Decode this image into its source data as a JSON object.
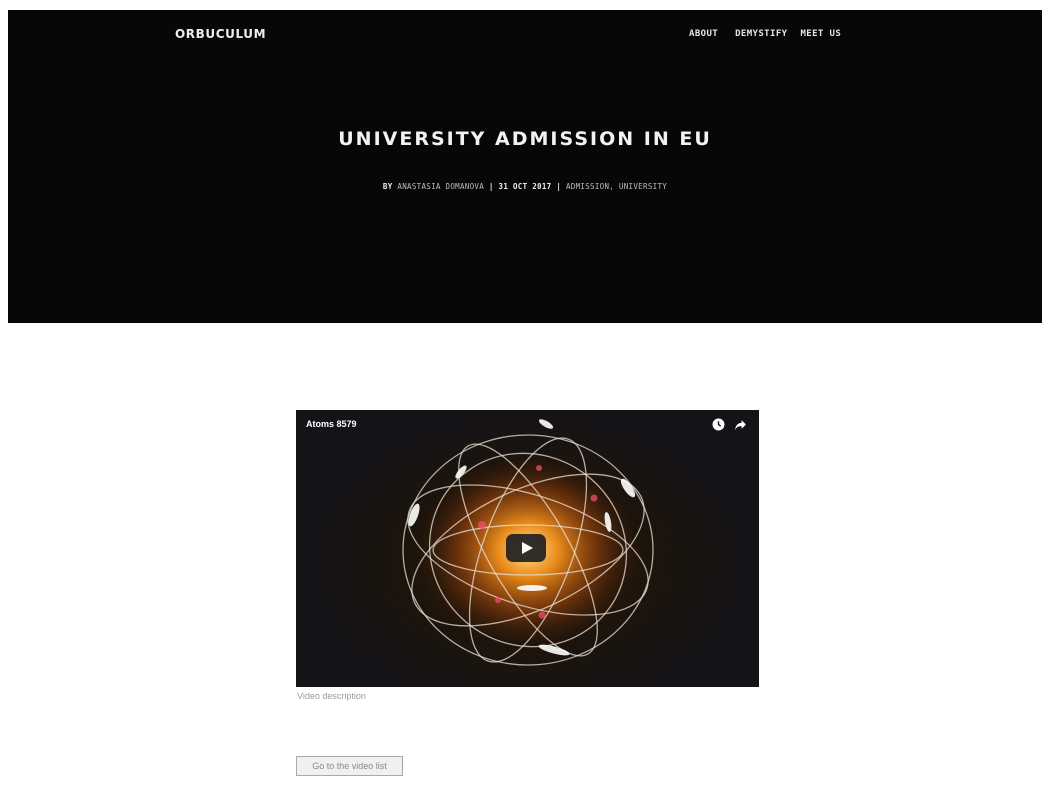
{
  "header": {
    "brand": "ORBUCULUM",
    "nav": [
      "ABOUT",
      "DEMYSTIFY",
      "MEET US"
    ]
  },
  "post": {
    "title": "UNIVERSITY ADMISSION IN EU",
    "by_prefix": "BY ",
    "author": "ANASTASIA DOMANOVA",
    "separator": " | ",
    "date": "31 OCT 2017",
    "tags": "ADMISSION, UNIVERSITY"
  },
  "video": {
    "title": "Atoms 8579",
    "icons": [
      "clock-icon",
      "share-icon"
    ],
    "play_icon": "play-icon",
    "description": "Video description"
  },
  "actions": {
    "go_to_list_label": "Go to the video list"
  },
  "colors": {
    "hero_bg": "#070708",
    "glow": "#ff9a1e",
    "particle_pink": "#ff4d7a"
  }
}
